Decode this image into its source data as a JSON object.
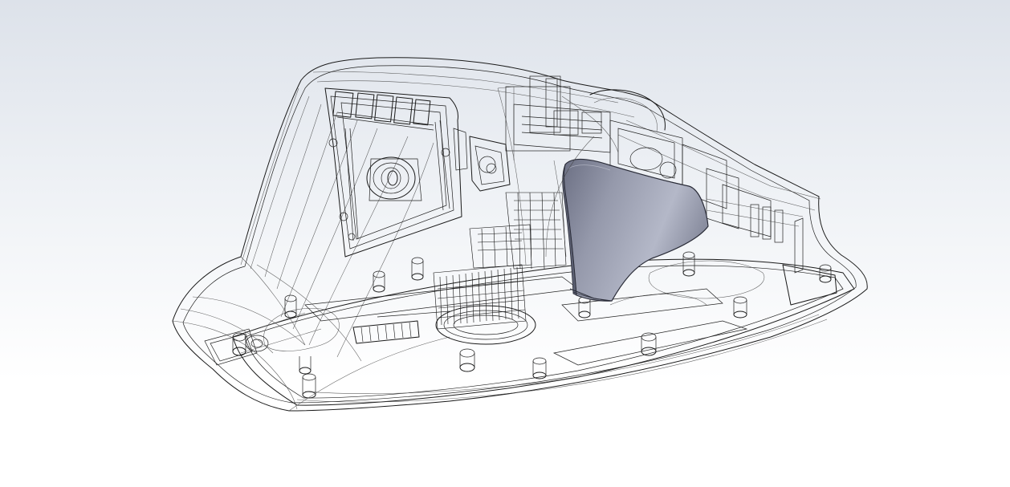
{
  "viewport": {
    "background_top": "#dde2ea",
    "background_bottom": "#ffffff"
  },
  "model": {
    "render_mode": "wireframe-transparent",
    "edge_color": "#1a1a1a",
    "highlighted_part": {
      "shading_color_light": "#b4b8c8",
      "shading_color_dark": "#6c7084",
      "edge_color": "#2a2c38"
    }
  }
}
